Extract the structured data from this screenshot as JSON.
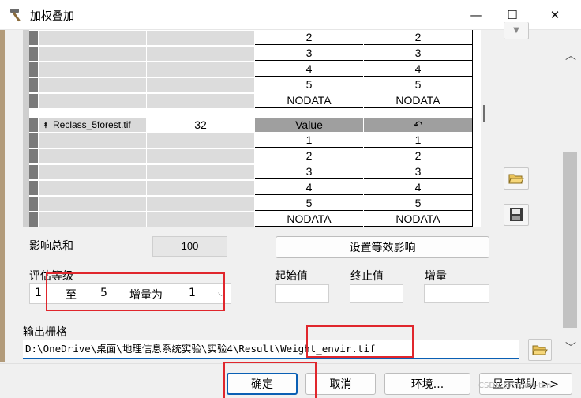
{
  "window": {
    "title": "加权叠加",
    "minimize_glyph": "—",
    "maximize_glyph": "☐",
    "close_glyph": "✕",
    "icon": "hammer-icon"
  },
  "grid": {
    "rows_top": [
      {
        "scale": "2",
        "value": "2"
      },
      {
        "scale": "3",
        "value": "3"
      },
      {
        "scale": "4",
        "value": "4"
      },
      {
        "scale": "5",
        "value": "5"
      },
      {
        "scale": "NODATA",
        "value": "NODATA"
      }
    ],
    "layer": {
      "name": "Reclass_5forest.tif",
      "influence": "32",
      "field": "Value",
      "undo_glyph": "↶"
    },
    "rows_bottom": [
      {
        "scale": "1",
        "value": "1"
      },
      {
        "scale": "2",
        "value": "2"
      },
      {
        "scale": "3",
        "value": "3"
      },
      {
        "scale": "4",
        "value": "4"
      },
      {
        "scale": "5",
        "value": "5"
      },
      {
        "scale": "NODATA",
        "value": "NODATA"
      }
    ]
  },
  "side_buttons": {
    "open_icon": "folder-open-icon",
    "save_icon": "floppy-disk-icon"
  },
  "influence_total": {
    "label": "影响总和",
    "value": "100"
  },
  "equal_influence_button": "设置等效影响",
  "evaluation_scale": {
    "label": "评估等级",
    "from": "1",
    "to_word": "至",
    "to": "5",
    "increment_word": "增量为",
    "increment": "1"
  },
  "range": {
    "start_label": "起始值",
    "end_label": "终止值",
    "step_label": "增量"
  },
  "output": {
    "label": "输出栅格",
    "path": "D:\\OneDrive\\桌面\\地理信息系统实验\\实验4\\Result\\Weight_envir.tif"
  },
  "footer": {
    "ok": "确定",
    "cancel": "取消",
    "environments": "环境...",
    "show_help": "显示帮助 >>"
  },
  "watermark": "CSDN @Stuart-tan",
  "colors": {
    "highlight_red": "#e0262c",
    "accent_blue": "#0a5fb4"
  }
}
